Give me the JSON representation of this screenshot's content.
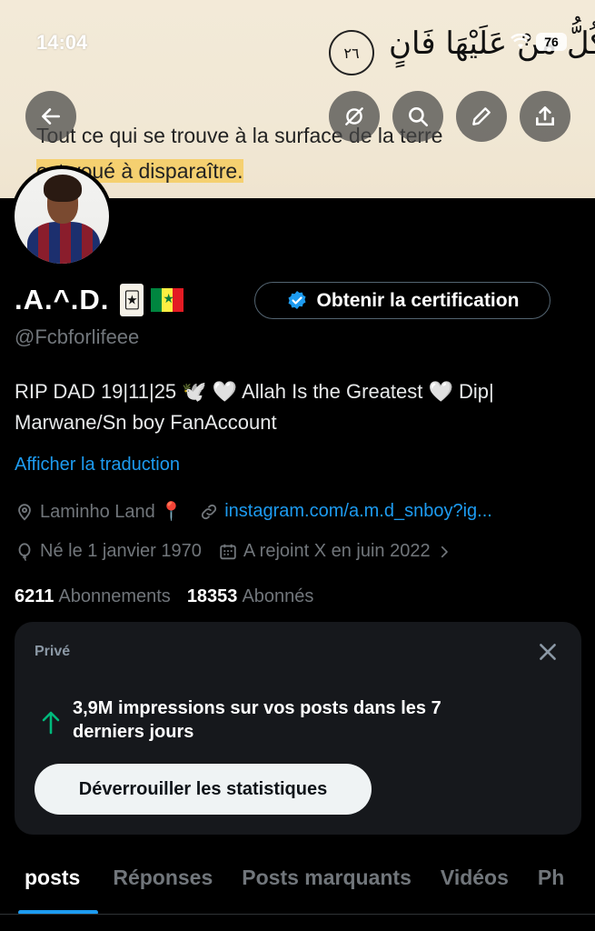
{
  "status_bar": {
    "time": "14:04",
    "battery": "76"
  },
  "banner": {
    "arabic_text": "كُلُّ مَنْ عَلَيْهَا فَانٍ",
    "verse_number": "٢٦",
    "caption_line1": "Tout ce qui se trouve à la surface de la terre",
    "caption_line2_prefix": "est voué à disparaître."
  },
  "profile": {
    "display_name": ".A.^.D.",
    "handle": "@Fcbforlifeee",
    "bio": "RIP DAD 19|11|25 🕊️ 🤍 Allah Is the Greatest 🤍 Dip| Marwane/Sn boy FanAccount",
    "translate_label": "Afficher la traduction",
    "location": "Laminho Land 📍",
    "website": "instagram.com/a.m.d_snboy?ig...",
    "birth": "Né le 1 janvier 1970",
    "joined": "A rejoint X en juin 2022",
    "following_count": "6211",
    "following_label": "Abonnements",
    "followers_count": "18353",
    "followers_label": "Abonnés"
  },
  "certification_button": "Obtenir la certification",
  "stats_card": {
    "label": "Privé",
    "text": "3,9M impressions sur vos posts dans les 7 derniers jours",
    "button": "Déverrouiller les statistiques"
  },
  "tabs": [
    "posts",
    "Réponses",
    "Posts marquants",
    "Vidéos",
    "Ph"
  ],
  "colors": {
    "accent": "#1d9bf0",
    "highlight": "#f5d070",
    "up_arrow": "#00ba7c"
  }
}
